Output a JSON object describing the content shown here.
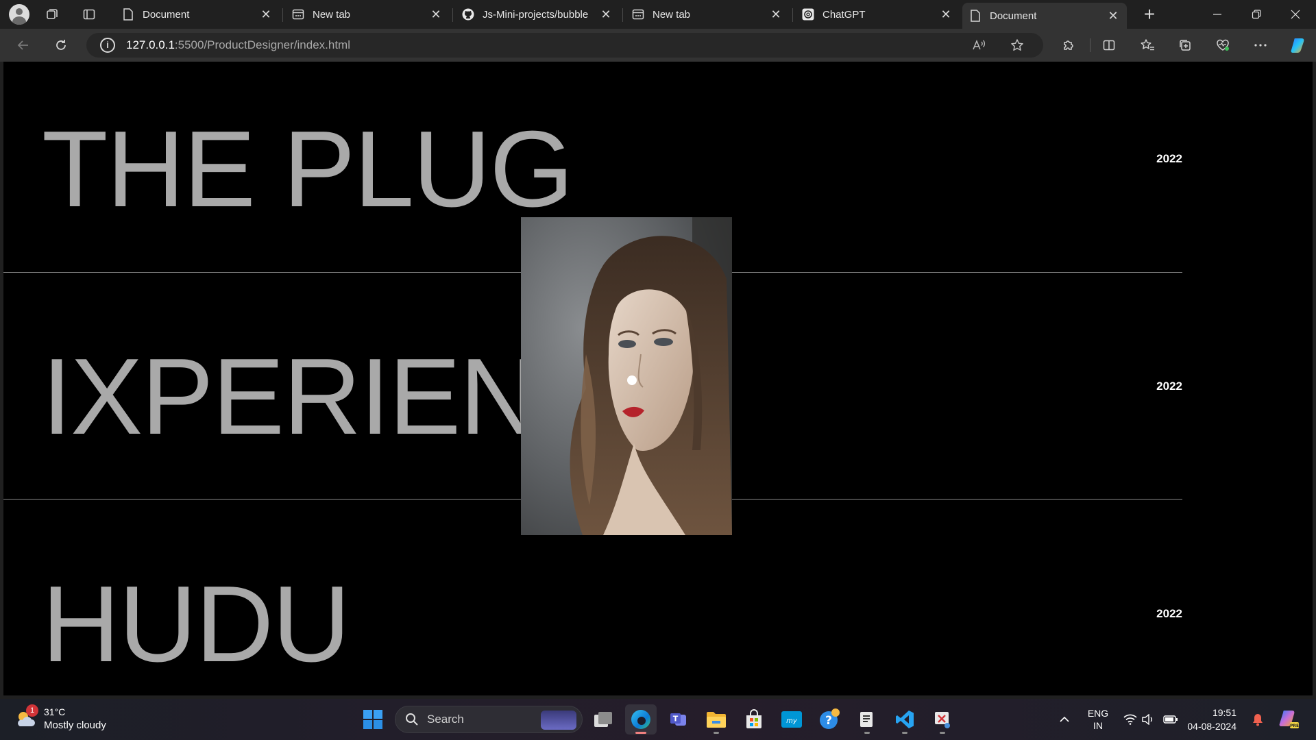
{
  "browser": {
    "tabs": [
      {
        "title": "Document",
        "favicon": "page-icon",
        "active": false
      },
      {
        "title": "New tab",
        "favicon": "newtab-icon",
        "active": false
      },
      {
        "title": "Js-Mini-projects/bubble",
        "favicon": "github-icon",
        "active": false
      },
      {
        "title": "New tab",
        "favicon": "newtab-icon",
        "active": false
      },
      {
        "title": "ChatGPT",
        "favicon": "chatgpt-icon",
        "active": false
      },
      {
        "title": "Document",
        "favicon": "page-icon",
        "active": true
      }
    ],
    "url_host": "127.0.0.1",
    "url_rest": ":5500/ProductDesigner/index.html"
  },
  "page": {
    "rows": [
      {
        "title": "THE PLUG",
        "year": "2022"
      },
      {
        "title": "IXPERIENC",
        "year": "2022"
      },
      {
        "title": "HUDU",
        "year": "2022"
      }
    ],
    "photo_alt": "portrait"
  },
  "taskbar": {
    "weather_temp": "31°C",
    "weather_condition": "Mostly cloudy",
    "weather_badge": "1",
    "search_label": "Search",
    "lang_top": "ENG",
    "lang_bottom": "IN",
    "time": "19:51",
    "date": "04-08-2024"
  },
  "colors": {
    "page_bg": "#000000",
    "title_text": "#a9a9a9",
    "year_text": "#ffffff",
    "browser_chrome": "#202020",
    "active_tab": "#333333"
  }
}
